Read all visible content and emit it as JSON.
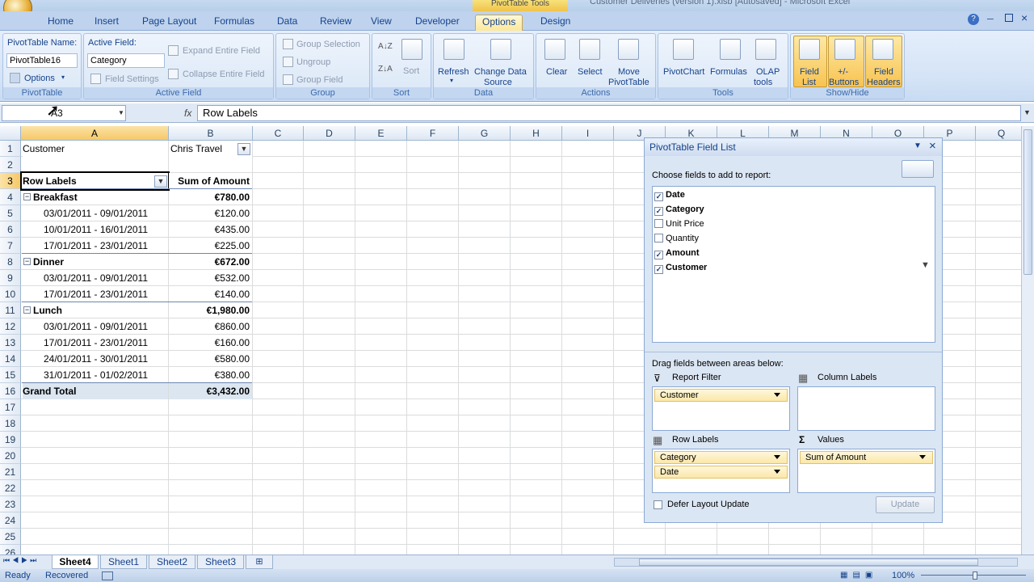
{
  "window": {
    "context_tab": "PivotTable Tools",
    "title": "Customer Deliveries (version 1).xlsb [Autosaved] - Microsoft Excel"
  },
  "tabs": [
    "Home",
    "Insert",
    "Page Layout",
    "Formulas",
    "Data",
    "Review",
    "View",
    "Developer",
    "Options",
    "Design"
  ],
  "active_tab": "Options",
  "ribbon": {
    "pivottable": {
      "name_label": "PivotTable Name:",
      "name_value": "PivotTable16",
      "options": "Options",
      "group": "PivotTable"
    },
    "active_field": {
      "label": "Active Field:",
      "value": "Category",
      "field_settings": "Field Settings",
      "expand": "Expand Entire Field",
      "collapse": "Collapse Entire Field",
      "group": "Active Field"
    },
    "group": {
      "group_selection": "Group Selection",
      "ungroup": "Ungroup",
      "group_field": "Group Field",
      "group": "Group"
    },
    "sort": {
      "sort": "Sort",
      "group": "Sort"
    },
    "data": {
      "refresh": "Refresh",
      "change_source_1": "Change Data",
      "change_source_2": "Source",
      "group": "Data"
    },
    "actions": {
      "clear": "Clear",
      "select": "Select",
      "move_1": "Move",
      "move_2": "PivotTable",
      "group": "Actions"
    },
    "tools": {
      "pivotchart": "PivotChart",
      "formulas": "Formulas",
      "olap_1": "OLAP",
      "olap_2": "tools",
      "group": "Tools"
    },
    "showhide": {
      "field_list_1": "Field",
      "field_list_2": "List",
      "buttons_1": "+/-",
      "buttons_2": "Buttons",
      "headers_1": "Field",
      "headers_2": "Headers",
      "group": "Show/Hide"
    }
  },
  "formula_bar": {
    "name_box": "A3",
    "formula": "Row Labels",
    "fx": "fx"
  },
  "columns": [
    "A",
    "B",
    "C",
    "D",
    "E",
    "F",
    "G",
    "H",
    "I",
    "J",
    "K",
    "L",
    "M",
    "N",
    "O",
    "P",
    "Q"
  ],
  "rows": [
    "1",
    "2",
    "3",
    "4",
    "5",
    "6",
    "7",
    "8",
    "9",
    "10",
    "11",
    "12",
    "13",
    "14",
    "15",
    "16",
    "17",
    "18",
    "19",
    "20",
    "21",
    "22",
    "23",
    "24",
    "25",
    "26"
  ],
  "sheet": {
    "filter_label": "Customer",
    "filter_value": "Chris Travel",
    "header_a": "Row Labels",
    "header_b": "Sum of Amount",
    "rows": [
      {
        "label": "Breakfast",
        "value": "€780.00",
        "type": "group"
      },
      {
        "label": "03/01/2011 - 09/01/2011",
        "value": "€120.00",
        "type": "item"
      },
      {
        "label": "10/01/2011 - 16/01/2011",
        "value": "€435.00",
        "type": "item"
      },
      {
        "label": "17/01/2011 - 23/01/2011",
        "value": "€225.00",
        "type": "item"
      },
      {
        "label": "Dinner",
        "value": "€672.00",
        "type": "group"
      },
      {
        "label": "03/01/2011 - 09/01/2011",
        "value": "€532.00",
        "type": "item"
      },
      {
        "label": "17/01/2011 - 23/01/2011",
        "value": "€140.00",
        "type": "item"
      },
      {
        "label": "Lunch",
        "value": "€1,980.00",
        "type": "group"
      },
      {
        "label": "03/01/2011 - 09/01/2011",
        "value": "€860.00",
        "type": "item"
      },
      {
        "label": "17/01/2011 - 23/01/2011",
        "value": "€160.00",
        "type": "item"
      },
      {
        "label": "24/01/2011 - 30/01/2011",
        "value": "€580.00",
        "type": "item"
      },
      {
        "label": "31/01/2011 - 01/02/2011",
        "value": "€380.00",
        "type": "item"
      }
    ],
    "grand_total_label": "Grand Total",
    "grand_total_value": "€3,432.00"
  },
  "field_list": {
    "title": "PivotTable Field List",
    "choose": "Choose fields to add to report:",
    "fields": [
      {
        "name": "Date",
        "checked": true
      },
      {
        "name": "Category",
        "checked": true
      },
      {
        "name": "Unit Price",
        "checked": false
      },
      {
        "name": "Quantity",
        "checked": false
      },
      {
        "name": "Amount",
        "checked": true
      },
      {
        "name": "Customer",
        "checked": true
      }
    ],
    "drag_label": "Drag fields between areas below:",
    "report_filter": "Report Filter",
    "column_labels": "Column Labels",
    "row_labels": "Row Labels",
    "values": "Values",
    "filter_items": [
      "Customer"
    ],
    "row_items": [
      "Category",
      "Date"
    ],
    "value_items": [
      "Sum of Amount"
    ],
    "defer": "Defer Layout Update",
    "update": "Update"
  },
  "sheet_tabs": [
    "Sheet4",
    "Sheet1",
    "Sheet2",
    "Sheet3"
  ],
  "active_sheet": "Sheet4",
  "status": {
    "ready": "Ready",
    "recovered": "Recovered",
    "zoom": "100%"
  }
}
